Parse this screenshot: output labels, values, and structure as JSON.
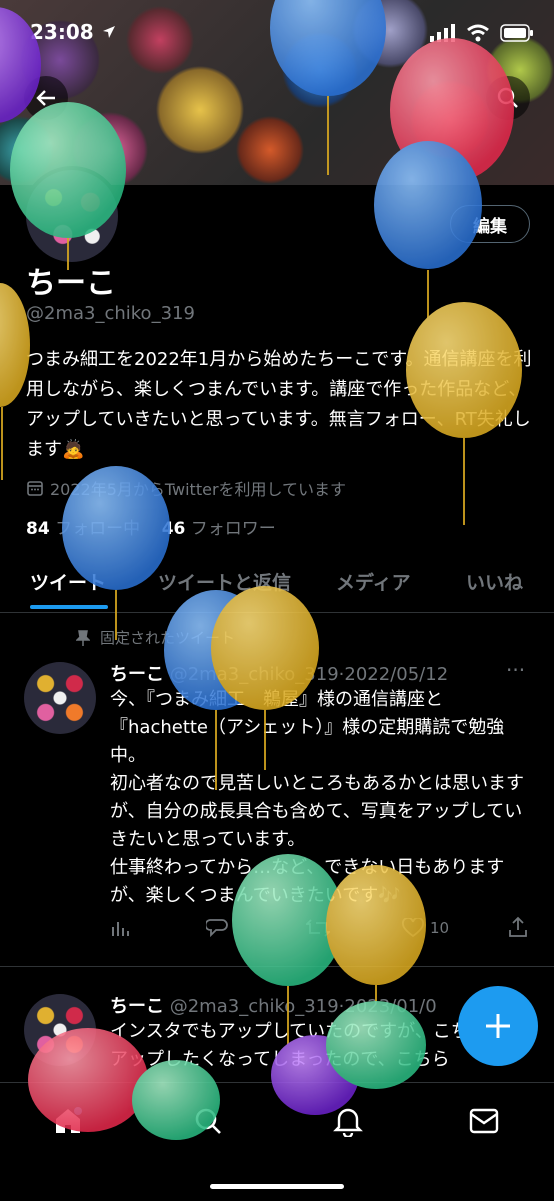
{
  "status_bar": {
    "time": "23:08"
  },
  "profile": {
    "name": "ちーこ",
    "handle": "@2ma3_chiko_319",
    "edit_label": "編集",
    "bio": "つまみ細工を2022年1月から始めたちーこです。通信講座を利用しながら、楽しくつまんでいます。講座で作った作品など、アップしていきたいと思っています。無言フォロー、RT失礼します🙇",
    "joined": "2022年5月からTwitterを利用しています",
    "following_count": "84",
    "following_label": "フォロー中",
    "followers_count": "46",
    "followers_label": "フォロワー"
  },
  "tabs": [
    "ツイート",
    "ツイートと返信",
    "メディア",
    "いいね"
  ],
  "pinned_label": "固定されたツイート",
  "tweets": [
    {
      "name": "ちーこ",
      "handle": "@2ma3_chiko_319",
      "date": "2022/05/12",
      "text": "今、『つまみ細工　鵜屋』様の通信講座と『hachette（アシェット）』様の定期購読で勉強中。\n初心者なので見苦しいところもあるかとは思いますが、自分の成長具合も含めて、写真をアップしていきたいと思っています。\n仕事終わってから…など、できない日もありますが、楽しくつまんでいきたいです🎶",
      "likes": "10"
    },
    {
      "name": "ちーこ",
      "handle": "@2ma3_chiko_319",
      "date": "2023/01/0",
      "text": "インスタでもアップしていたのですが、こちらでもアップしたくなってしまったので、こちら"
    }
  ],
  "colors": {
    "accent": "#1d9bf0",
    "background": "#000000",
    "muted": "#71767b"
  },
  "icons": [
    "back-arrow-icon",
    "search-icon",
    "calendar-icon",
    "pin-icon",
    "more-icon",
    "analytics-icon",
    "reply-icon",
    "retweet-icon",
    "like-icon",
    "share-icon",
    "plus-icon",
    "home-icon",
    "explore-icon",
    "notifications-icon",
    "messages-icon"
  ]
}
